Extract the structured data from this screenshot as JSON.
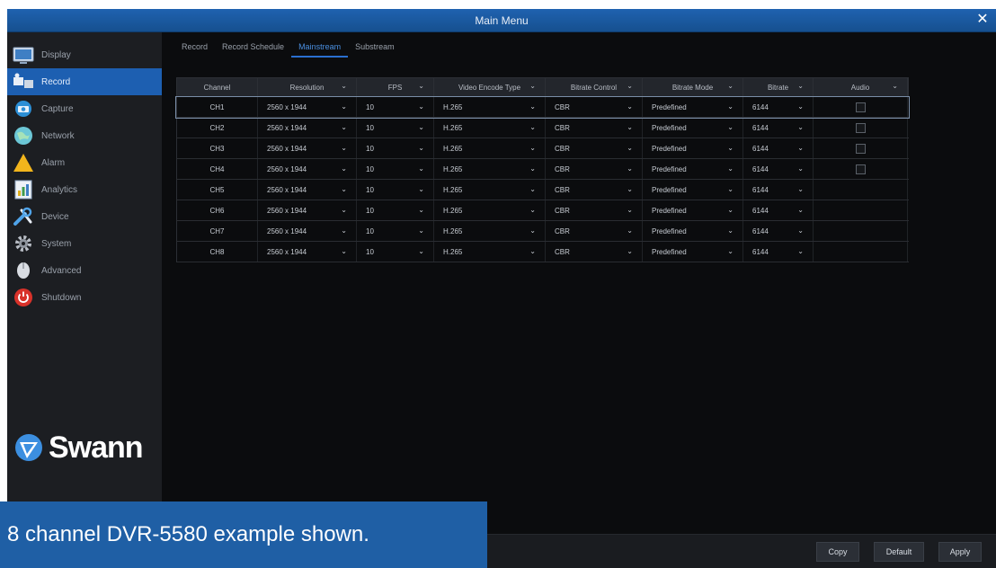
{
  "window": {
    "title": "Main Menu",
    "close_glyph": "✕"
  },
  "sidebar": {
    "items": [
      {
        "label": "Display",
        "icon": "display-icon",
        "active": false
      },
      {
        "label": "Record",
        "icon": "record-icon",
        "active": true
      },
      {
        "label": "Capture",
        "icon": "camera-icon",
        "active": false
      },
      {
        "label": "Network",
        "icon": "globe-icon",
        "active": false
      },
      {
        "label": "Alarm",
        "icon": "warning-icon",
        "active": false
      },
      {
        "label": "Analytics",
        "icon": "chart-icon",
        "active": false
      },
      {
        "label": "Device",
        "icon": "tools-icon",
        "active": false
      },
      {
        "label": "System",
        "icon": "gear-icon",
        "active": false
      },
      {
        "label": "Advanced",
        "icon": "mouse-icon",
        "active": false
      },
      {
        "label": "Shutdown",
        "icon": "power-icon",
        "active": false
      }
    ],
    "logo_text": "Swann",
    "logo_icon": "swann-logo-icon"
  },
  "tabs": [
    {
      "label": "Record",
      "active": false
    },
    {
      "label": "Record Schedule",
      "active": false
    },
    {
      "label": "Mainstream",
      "active": true
    },
    {
      "label": "Substream",
      "active": false
    }
  ],
  "table": {
    "headers": [
      "Channel",
      "Resolution",
      "FPS",
      "Video Encode Type",
      "Bitrate Control",
      "Bitrate Mode",
      "Bitrate",
      "Audio"
    ],
    "chevron": "⌄",
    "rows": [
      {
        "channel": "CH1",
        "resolution": "2560 x 1944",
        "fps": "10",
        "encode": "H.265",
        "control": "CBR",
        "mode": "Predefined",
        "bitrate": "6144",
        "audio": true
      },
      {
        "channel": "CH2",
        "resolution": "2560 x 1944",
        "fps": "10",
        "encode": "H.265",
        "control": "CBR",
        "mode": "Predefined",
        "bitrate": "6144",
        "audio": true
      },
      {
        "channel": "CH3",
        "resolution": "2560 x 1944",
        "fps": "10",
        "encode": "H.265",
        "control": "CBR",
        "mode": "Predefined",
        "bitrate": "6144",
        "audio": true
      },
      {
        "channel": "CH4",
        "resolution": "2560 x 1944",
        "fps": "10",
        "encode": "H.265",
        "control": "CBR",
        "mode": "Predefined",
        "bitrate": "6144",
        "audio": true
      },
      {
        "channel": "CH5",
        "resolution": "2560 x 1944",
        "fps": "10",
        "encode": "H.265",
        "control": "CBR",
        "mode": "Predefined",
        "bitrate": "6144",
        "audio": false
      },
      {
        "channel": "CH6",
        "resolution": "2560 x 1944",
        "fps": "10",
        "encode": "H.265",
        "control": "CBR",
        "mode": "Predefined",
        "bitrate": "6144",
        "audio": false
      },
      {
        "channel": "CH7",
        "resolution": "2560 x 1944",
        "fps": "10",
        "encode": "H.265",
        "control": "CBR",
        "mode": "Predefined",
        "bitrate": "6144",
        "audio": false
      },
      {
        "channel": "CH8",
        "resolution": "2560 x 1944",
        "fps": "10",
        "encode": "H.265",
        "control": "CBR",
        "mode": "Predefined",
        "bitrate": "6144",
        "audio": false
      }
    ],
    "selected_row": 0
  },
  "buttons": {
    "copy": "Copy",
    "default": "Default",
    "apply": "Apply"
  },
  "caption": "8 channel DVR-5580 example shown.",
  "colors": {
    "accent": "#1d5fb1",
    "titlebar": "#1f62b0",
    "caption_bg": "#1f5fa5"
  }
}
